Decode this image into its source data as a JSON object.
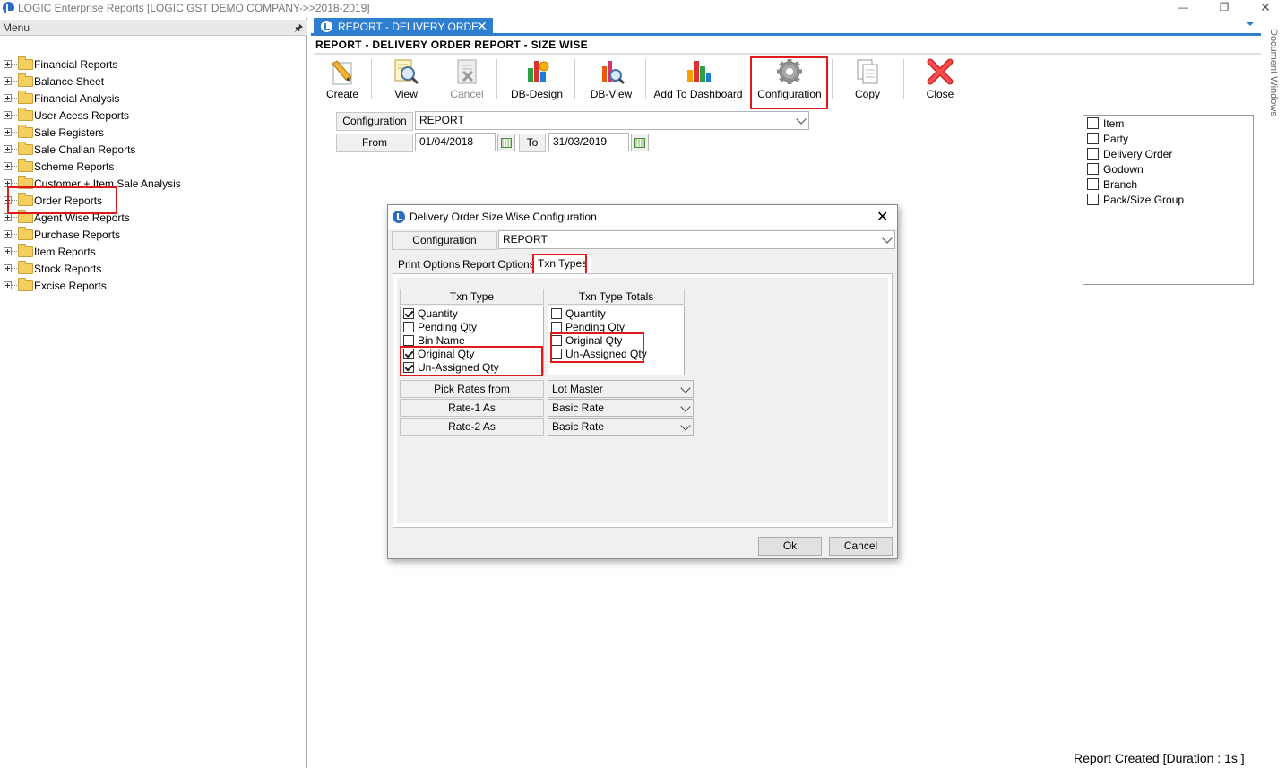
{
  "window": {
    "title": "LOGIC Enterprise Reports  [LOGIC GST DEMO COMPANY->>2018-2019]"
  },
  "menu": {
    "title": "Menu",
    "items": [
      {
        "label": "Financial Reports"
      },
      {
        "label": "Balance Sheet"
      },
      {
        "label": "Financial Analysis"
      },
      {
        "label": "User Acess Reports"
      },
      {
        "label": "Sale Registers"
      },
      {
        "label": "Sale Challan Reports"
      },
      {
        "label": "Scheme Reports"
      },
      {
        "label": "Customer + Item Sale Analysis"
      },
      {
        "label": "Order Reports"
      },
      {
        "label": "Agent Wise Reports"
      },
      {
        "label": "Purchase Reports"
      },
      {
        "label": "Item Reports"
      },
      {
        "label": "Stock Reports"
      },
      {
        "label": "Excise Reports"
      }
    ]
  },
  "doc_tab": {
    "label": "REPORT - DELIVERY ORDE...",
    "close": "✕"
  },
  "report": {
    "heading": "REPORT - DELIVERY ORDER REPORT - SIZE WISE"
  },
  "toolbar": {
    "create": "Create",
    "view": "View",
    "cancel": "Cancel",
    "db_design": "DB-Design",
    "db_view": "DB-View",
    "add_dashboard": "Add To Dashboard",
    "configuration": "Configuration",
    "copy": "Copy",
    "close": "Close"
  },
  "form": {
    "configuration_label": "Configuration",
    "configuration_value": "REPORT",
    "from_label": "From",
    "from_value": "01/04/2018",
    "to_label": "To",
    "to_value": "31/03/2019"
  },
  "right_panel": {
    "items": [
      {
        "label": "Item",
        "checked": false
      },
      {
        "label": "Party",
        "checked": false
      },
      {
        "label": "Delivery Order",
        "checked": false
      },
      {
        "label": "Godown",
        "checked": false
      },
      {
        "label": "Branch",
        "checked": false
      },
      {
        "label": "Pack/Size Group",
        "checked": false
      }
    ]
  },
  "side_tab": {
    "label": "Document Windows"
  },
  "status": {
    "text": "Report Created [Duration : 1s ]"
  },
  "dialog": {
    "title": "Delivery Order Size Wise Configuration",
    "close": "✕",
    "configuration_label": "Configuration",
    "configuration_value": "REPORT",
    "tabs": [
      {
        "label": "Print Options"
      },
      {
        "label": "Report Options"
      },
      {
        "label": "Txn Types"
      }
    ],
    "active_tab": "Txn Types",
    "txn_type": {
      "header": "Txn Type",
      "items": [
        {
          "label": "Quantity",
          "checked": true
        },
        {
          "label": "Pending Qty",
          "checked": false
        },
        {
          "label": "Bin Name",
          "checked": false
        },
        {
          "label": "Original Qty",
          "checked": true
        },
        {
          "label": "Un-Assigned Qty",
          "checked": true
        }
      ]
    },
    "txn_type_totals": {
      "header": "Txn Type Totals",
      "items": [
        {
          "label": "Quantity",
          "checked": false
        },
        {
          "label": "Pending Qty",
          "checked": false
        },
        {
          "label": "Original Qty",
          "checked": false
        },
        {
          "label": "Un-Assigned Qty",
          "checked": false
        }
      ]
    },
    "pick_rates_label": "Pick Rates from",
    "pick_rates_value": "Lot Master",
    "rate1_label": "Rate-1 As",
    "rate1_value": "Basic Rate",
    "rate2_label": "Rate-2 As",
    "rate2_value": "Basic Rate",
    "ok": "Ok",
    "cancel": "Cancel"
  }
}
